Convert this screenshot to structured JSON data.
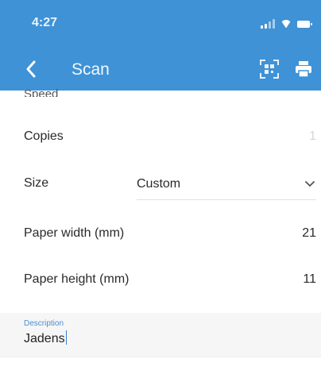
{
  "status": {
    "time": "4:27"
  },
  "header": {
    "title": "Scan",
    "icons": [
      "chevron-left-icon",
      "qr-scan-icon",
      "print-icon"
    ]
  },
  "settings": {
    "speed_label_partial": "Speed",
    "copies": {
      "label": "Copies",
      "value": "1"
    },
    "size": {
      "label": "Size",
      "selected": "Custom"
    },
    "paper_width": {
      "label": "Paper width (mm)",
      "value": "21"
    },
    "paper_height": {
      "label": "Paper height (mm)",
      "value": "11"
    }
  },
  "description": {
    "caption": "Description",
    "value": "Jadens"
  },
  "colors": {
    "app_bar": "#3f92d6",
    "accent": "#4a8fd1"
  }
}
